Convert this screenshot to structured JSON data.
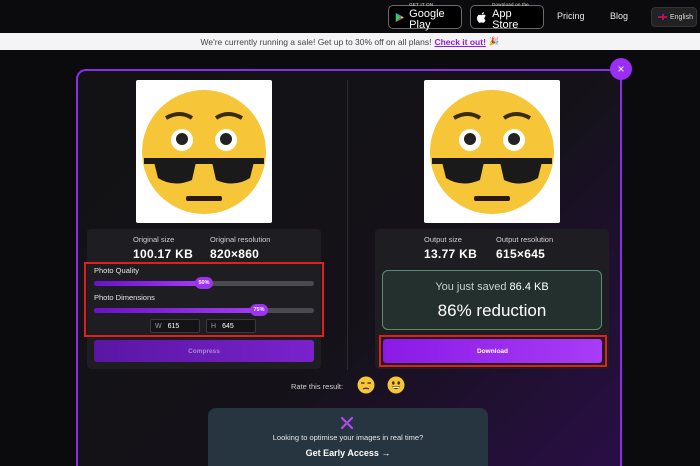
{
  "nav": {
    "google_play_small": "GET IT ON",
    "google_play_big": "Google Play",
    "app_store_small": "Download on the",
    "app_store_big": "App Store",
    "pricing": "Pricing",
    "blog": "Blog",
    "language": "English"
  },
  "banner": {
    "text": "We're currently running a sale! Get up to 30% off on all plans!",
    "link": "Check it out!",
    "emoji": "🎉"
  },
  "dialog": {
    "close_glyph": "×"
  },
  "original": {
    "size_label": "Original size",
    "size_value": "100.17 KB",
    "resolution_label": "Original resolution",
    "resolution_value": "820×860",
    "quality_label": "Photo Quality",
    "quality_percent": 50,
    "quality_percent_label": "50%",
    "dimensions_label": "Photo Dimensions",
    "dimensions_percent": 75,
    "dimensions_percent_label": "75%",
    "width_key": "W",
    "width_value": "615",
    "height_key": "H",
    "height_value": "645",
    "compress_label": "Compress"
  },
  "output": {
    "size_label": "Output size",
    "size_value": "13.77 KB",
    "resolution_label": "Output resolution",
    "resolution_value": "615×645",
    "saved_prefix": "You just saved",
    "saved_value": "86.4 KB",
    "reduction": "86% reduction",
    "download_label": "Download"
  },
  "rating": {
    "label": "Rate this result:",
    "options": [
      "unamused-face-icon",
      "grinning-face-icon"
    ]
  },
  "promo": {
    "text": "Looking to optimise your images in real time?",
    "cta": "Get Early Access →"
  },
  "colors": {
    "accent": "#9a2ef2",
    "highlight": "#e0201c",
    "saved_border": "#5d8a74"
  }
}
